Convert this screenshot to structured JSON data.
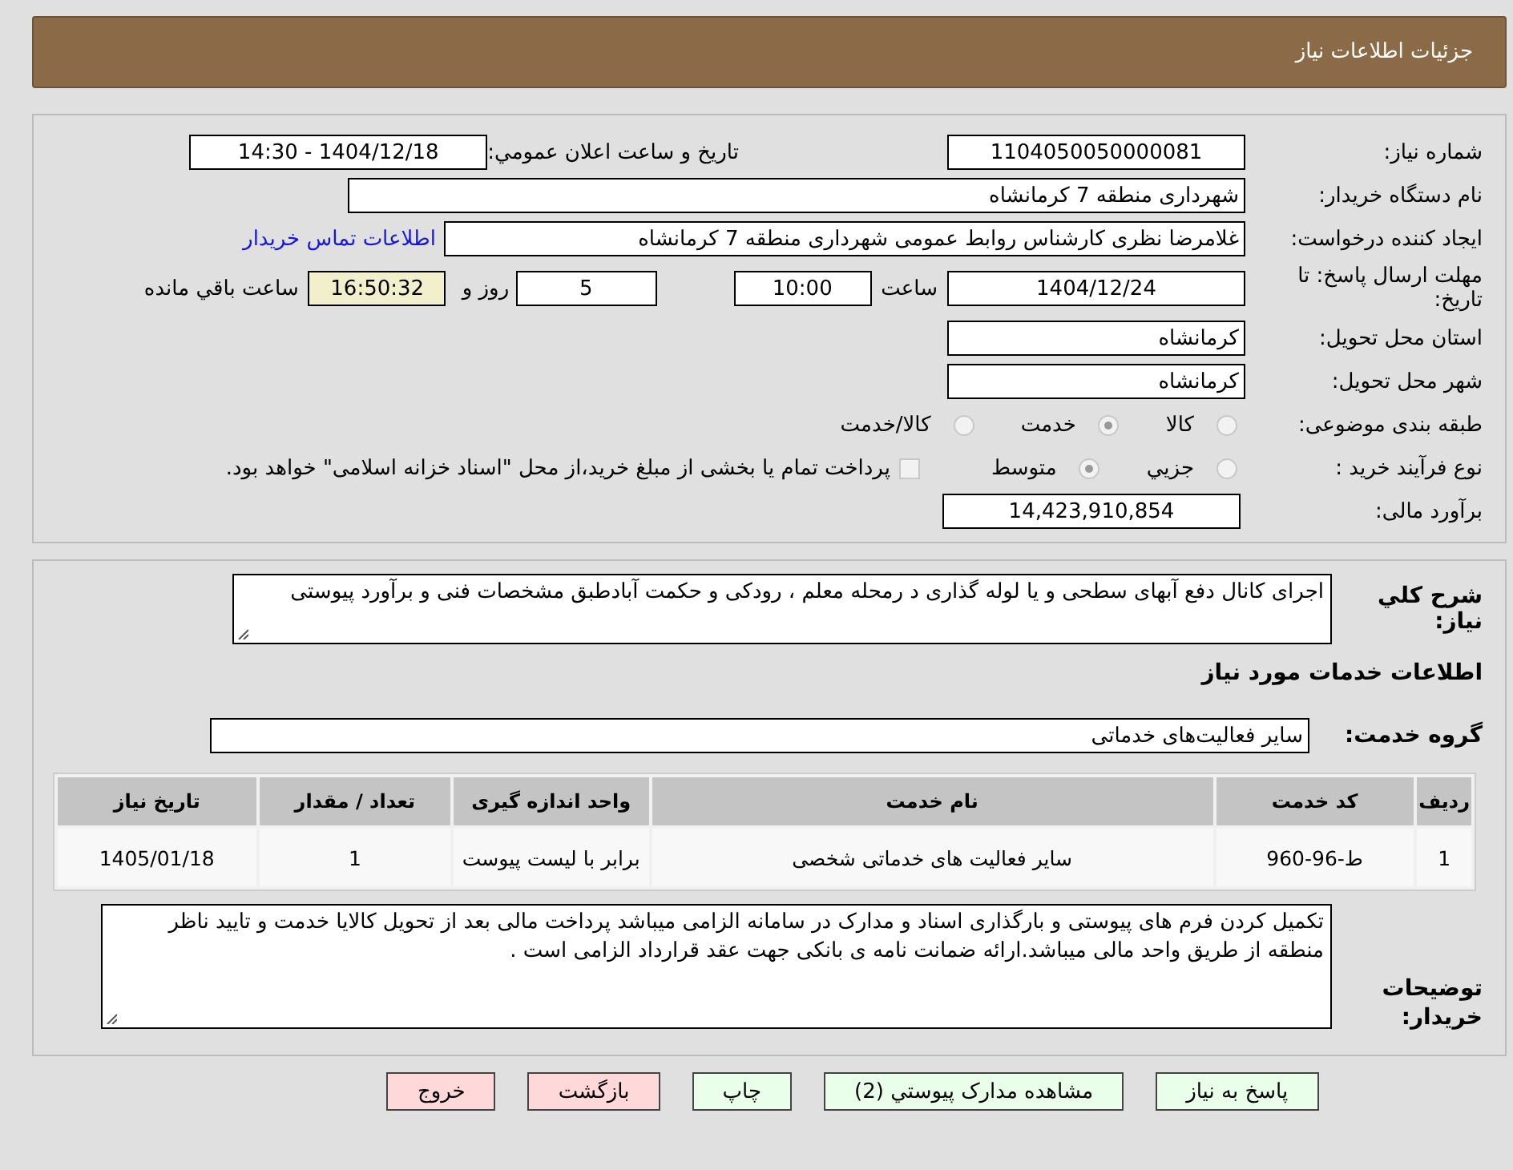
{
  "header": {
    "title": "جزئیات اطلاعات نیاز"
  },
  "need_number": {
    "label": "شماره نیاز:",
    "value": "1104050050000081"
  },
  "announce_date": {
    "label": "تاریخ و ساعت اعلان عمومي:",
    "value": "1404/12/18 - 14:30"
  },
  "buyer_org": {
    "label": "نام دستگاه خریدار:",
    "value": "شهرداری منطقه 7 کرمانشاه"
  },
  "requester": {
    "label": "ایجاد کننده درخواست:",
    "value": "غلامرضا نظری کارشناس روابط عمومی شهرداری منطقه 7 کرمانشاه",
    "link": "اطلاعات تماس خریدار"
  },
  "deadline": {
    "label": "مهلت ارسال پاسخ: تا تاریخ:",
    "date": "1404/12/24",
    "time_label": "ساعت",
    "time": "10:00",
    "days": "5",
    "days_label": "روز و",
    "remaining": "16:50:32",
    "remaining_label": "ساعت باقي مانده"
  },
  "province": {
    "label": "استان محل تحویل:",
    "value": "کرمانشاه"
  },
  "city": {
    "label": "شهر محل تحویل:",
    "value": "کرمانشاه"
  },
  "category": {
    "label": "طبقه بندی موضوعی:",
    "options": [
      {
        "label": "کالا",
        "selected": false
      },
      {
        "label": "خدمت",
        "selected": true
      },
      {
        "label": "کالا/خدمت",
        "selected": false
      }
    ]
  },
  "process": {
    "label": "نوع فرآیند خرید :",
    "options": [
      {
        "label": "جزيي",
        "selected": false
      },
      {
        "label": "متوسط",
        "selected": true
      }
    ],
    "treasury": {
      "checked": false,
      "text": "پرداخت تمام یا بخشی از مبلغ خرید،از محل \"اسناد خزانه اسلامی\" خواهد بود."
    }
  },
  "budget": {
    "label": "برآورد مالی:",
    "value": "14,423,910,854"
  },
  "description": {
    "label": "شرح كلي نياز:",
    "value": "اجرای کانال دفع آبهای سطحی و یا لوله گذاری د رمحله معلم ، رودکی و حکمت آبادطبق مشخصات فنی و برآورد پیوستی"
  },
  "services_heading": "اطلاعات خدمات مورد نیاز",
  "service_group": {
    "label": "گروه خدمت:",
    "value": "سایر فعالیت‌های خدماتی"
  },
  "table": {
    "columns": [
      "ردیف",
      "کد خدمت",
      "نام خدمت",
      "واحد اندازه گیری",
      "تعداد / مقدار",
      "تاریخ نیاز"
    ],
    "rows": [
      [
        "1",
        "ط-96-960",
        "سایر فعالیت های خدماتی شخصی",
        "برابر با لیست پیوست",
        "1",
        "1405/01/18"
      ]
    ]
  },
  "buyer_notes": {
    "label": "توضیحات خریدار:",
    "value": "تکمیل کردن فرم های پیوستی و بارگذاری اسناد و مدارک در سامانه الزامی میباشد پرداخت مالی بعد از تحویل کالایا خدمت و تایید ناظر منطقه از طریق واحد مالی میباشد.ارائه ضمانت نامه ی بانکی جهت عقد قرارداد الزامی است ."
  },
  "buttons": [
    {
      "label": "پاسخ به نیاز",
      "kind": "normal"
    },
    {
      "label": "مشاهده مدارک پیوستي (2)",
      "kind": "normal"
    },
    {
      "label": "چاپ",
      "kind": "normal"
    },
    {
      "label": "بازگشت",
      "kind": "danger"
    },
    {
      "label": "خروج",
      "kind": "danger"
    }
  ]
}
